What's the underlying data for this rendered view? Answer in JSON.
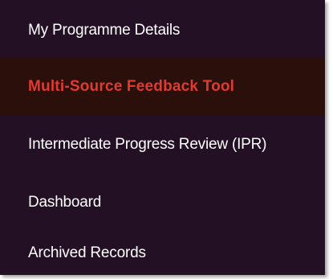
{
  "menu": {
    "items": [
      {
        "label": "My Programme Details",
        "active": false
      },
      {
        "label": "Multi-Source Feedback Tool",
        "active": true
      },
      {
        "label": "Intermediate Progress Review (IPR)",
        "active": false
      },
      {
        "label": "Dashboard",
        "active": false
      },
      {
        "label": "Archived Records",
        "active": false
      }
    ]
  },
  "colors": {
    "background": "#241024",
    "active_background": "#2b0f0b",
    "active_text": "#e13a2f",
    "text": "#ffffff"
  }
}
